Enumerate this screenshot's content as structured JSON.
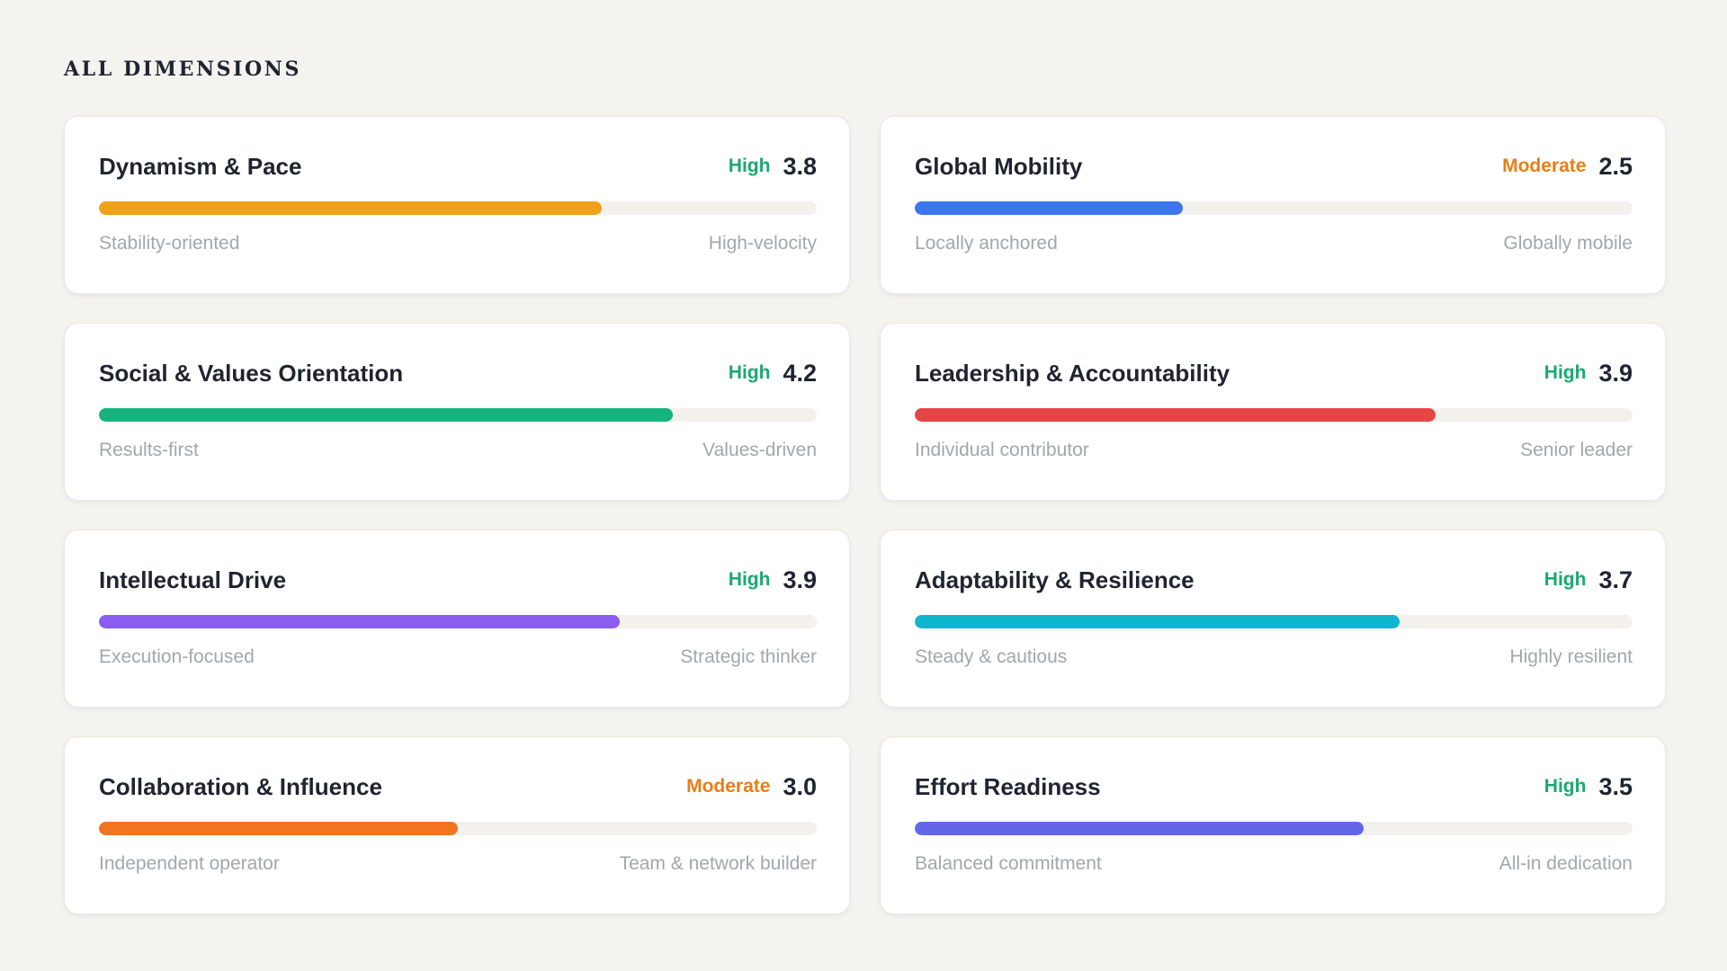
{
  "section_title": "ALL DIMENSIONS",
  "dimensions": [
    {
      "title": "Dynamism & Pace",
      "level": "High",
      "level_type": "high",
      "score": "3.8",
      "progress": 0.7,
      "color": "#f0a11a",
      "low_label": "Stability-oriented",
      "high_label": "High-velocity"
    },
    {
      "title": "Global Mobility",
      "level": "Moderate",
      "level_type": "moderate",
      "score": "2.5",
      "progress": 0.373,
      "color": "#3b76ec",
      "low_label": "Locally anchored",
      "high_label": "Globally mobile"
    },
    {
      "title": "Social & Values Orientation",
      "level": "High",
      "level_type": "high",
      "score": "4.2",
      "progress": 0.8,
      "color": "#16b37e",
      "low_label": "Results-first",
      "high_label": "Values-driven"
    },
    {
      "title": "Leadership & Accountability",
      "level": "High",
      "level_type": "high",
      "score": "3.9",
      "progress": 0.725,
      "color": "#e54545",
      "low_label": "Individual contributor",
      "high_label": "Senior leader"
    },
    {
      "title": "Intellectual Drive",
      "level": "High",
      "level_type": "high",
      "score": "3.9",
      "progress": 0.725,
      "color": "#8b5cf0",
      "low_label": "Execution-focused",
      "high_label": "Strategic thinker"
    },
    {
      "title": "Adaptability & Resilience",
      "level": "High",
      "level_type": "high",
      "score": "3.7",
      "progress": 0.675,
      "color": "#10b5cf",
      "low_label": "Steady & cautious",
      "high_label": "Highly resilient"
    },
    {
      "title": "Collaboration & Influence",
      "level": "Moderate",
      "level_type": "moderate",
      "score": "3.0",
      "progress": 0.5,
      "color": "#f2741f",
      "low_label": "Independent operator",
      "high_label": "Team & network builder"
    },
    {
      "title": "Effort Readiness",
      "level": "High",
      "level_type": "high",
      "score": "3.5",
      "progress": 0.625,
      "color": "#6366e8",
      "low_label": "Balanced commitment",
      "high_label": "All-in dedication"
    }
  ]
}
